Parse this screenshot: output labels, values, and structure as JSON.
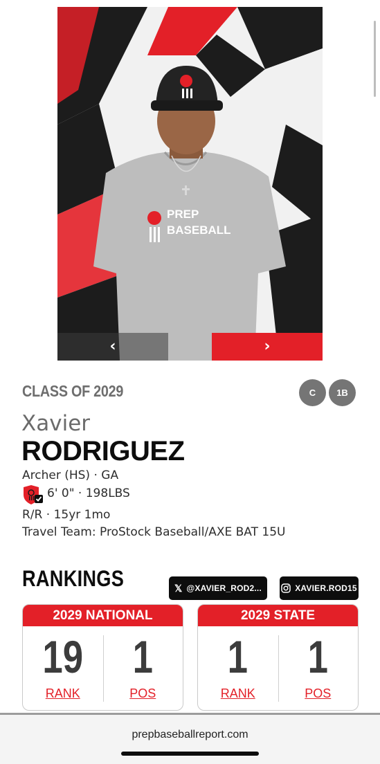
{
  "carousel": {
    "prev_label": "‹",
    "next_label": "›",
    "photo_alt": "Player photo in Prep Baseball shirt and cap",
    "shirt_text_line1": "PREP",
    "shirt_text_line2": "BASEBALL"
  },
  "player": {
    "class_of": "CLASS OF 2029",
    "positions": [
      "C",
      "1B"
    ],
    "first_name": "Xavier",
    "last_name": "RODRIGUEZ",
    "school": "Archer (HS) · GA",
    "height_weight": "6' 0\" · 198LBS",
    "bats_throws_age": "R/R · 15yr 1mo",
    "travel_team": "Travel Team: ProStock Baseball/AXE BAT 15U"
  },
  "rankings": {
    "title": "RANKINGS",
    "social": {
      "x_handle": "@XAVIER_ROD2...",
      "instagram_handle": "XAVIER.ROD15"
    },
    "cards": [
      {
        "title": "2029 NATIONAL",
        "rank": "19",
        "rank_label": "RANK",
        "pos": "1",
        "pos_label": "POS"
      },
      {
        "title": "2029 STATE",
        "rank": "1",
        "rank_label": "RANK",
        "pos": "1",
        "pos_label": "POS"
      }
    ]
  },
  "browser": {
    "url": "prepbaseballreport.com"
  },
  "colors": {
    "brand_red": "#e32028",
    "dark": "#0d0d0d",
    "gray_text": "#6e6e6e"
  }
}
